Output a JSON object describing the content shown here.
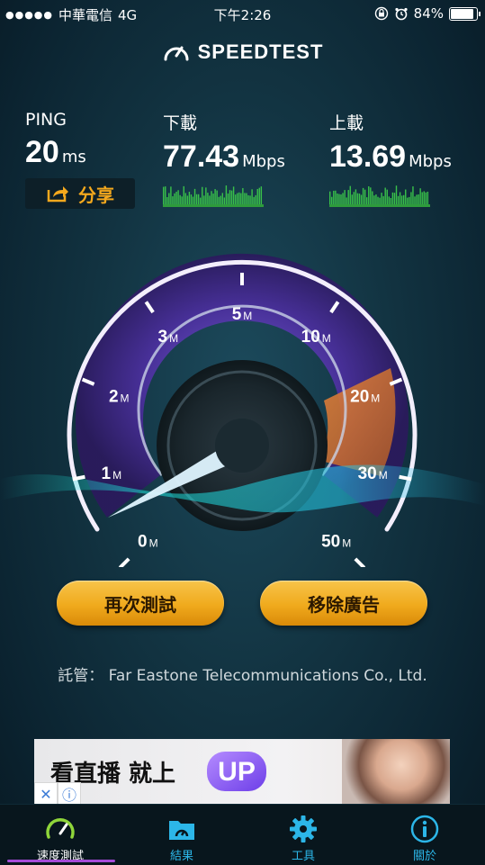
{
  "status_bar": {
    "carrier": "中華電信",
    "network": "4G",
    "time": "下午2:26",
    "battery": "84%",
    "battery_level": 0.84
  },
  "brand": {
    "name": "SPEEDTEST"
  },
  "metrics": {
    "ping": {
      "label": "PING",
      "value": "20",
      "unit": "ms"
    },
    "download": {
      "label": "下載",
      "value": "77.43",
      "unit": "Mbps"
    },
    "upload": {
      "label": "上載",
      "value": "13.69",
      "unit": "Mbps"
    }
  },
  "share": {
    "label": "分享"
  },
  "gauge": {
    "ticks": [
      {
        "num": "0",
        "unit": "M"
      },
      {
        "num": "1",
        "unit": "M"
      },
      {
        "num": "2",
        "unit": "M"
      },
      {
        "num": "3",
        "unit": "M"
      },
      {
        "num": "5",
        "unit": "M"
      },
      {
        "num": "10",
        "unit": "M"
      },
      {
        "num": "20",
        "unit": "M"
      },
      {
        "num": "30",
        "unit": "M"
      },
      {
        "num": "50",
        "unit": "M"
      }
    ]
  },
  "buttons": {
    "retest": "再次測試",
    "remove_ads": "移除廣告"
  },
  "host": {
    "label": "託管：",
    "name": "Far Eastone Telecommunications Co., Ltd."
  },
  "ad": {
    "headline": "看直播 就上",
    "logo_text": "UP",
    "close_glyph": "✕",
    "info_glyph": "ⓘ"
  },
  "tabs": [
    {
      "label": "速度測試",
      "icon": "speedometer-icon",
      "active": true
    },
    {
      "label": "結果",
      "icon": "results-folder-icon",
      "active": false
    },
    {
      "label": "工具",
      "icon": "gear-icon",
      "active": false
    },
    {
      "label": "關於",
      "icon": "info-icon",
      "active": false
    }
  ],
  "colors": {
    "accent_orange": "#f0aa1d",
    "tab_blue": "#2cb6e8",
    "gauge_purple": "#7b4fd6",
    "active_underline": "#a54bd8"
  }
}
